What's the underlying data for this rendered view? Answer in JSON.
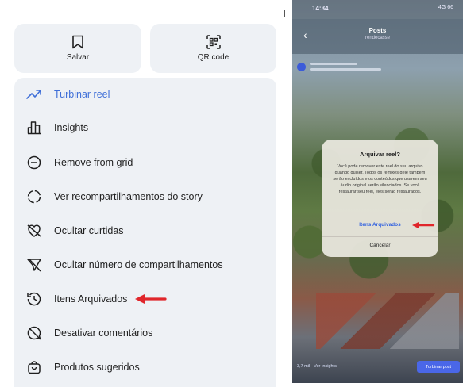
{
  "share_sheet": {
    "cards": [
      {
        "label": "Salvar",
        "icon": "bookmark-icon"
      },
      {
        "label": "QR code",
        "icon": "qr-code-icon"
      }
    ],
    "menu": [
      {
        "label": "Turbinar reel",
        "icon": "trending-up-icon",
        "highlight": true
      },
      {
        "label": "Insights",
        "icon": "bar-chart-icon"
      },
      {
        "label": "Remove from grid",
        "icon": "minus-circle-icon"
      },
      {
        "label": "Ver recompartilhamentos do story",
        "icon": "dashed-circle-icon"
      },
      {
        "label": "Ocultar curtidas",
        "icon": "heart-off-icon"
      },
      {
        "label": "Ocultar número de compartilhamentos",
        "icon": "send-off-icon"
      },
      {
        "label": "Itens Arquivados",
        "icon": "archive-clock-icon"
      },
      {
        "label": "Desativar comentários",
        "icon": "comment-off-icon"
      },
      {
        "label": "Produtos sugeridos",
        "icon": "shopping-bag-icon"
      }
    ]
  },
  "phone": {
    "status": {
      "time": "14:34",
      "signal": "4G 66"
    },
    "header": {
      "title": "Posts",
      "subtitle": "rendecasse"
    },
    "dialog": {
      "title": "Arquivar reel?",
      "body": "Você pode remover este reel do seu arquivo quando quiser. Todos os remixes dele também serão excluídos e os conteúdos que usarem seu áudio original serão silenciados. Se você restaurar seu reel, eles serão restaurados.",
      "primary": "Itens Arquivados",
      "secondary": "Cancelar"
    },
    "bottom": {
      "views": "3,7 mil · Ver Insights",
      "button": "Turbinar post"
    }
  },
  "colors": {
    "accent_blue": "#3f6fd8",
    "arrow_red": "#e0262b",
    "panel_bg": "#eef1f5"
  }
}
